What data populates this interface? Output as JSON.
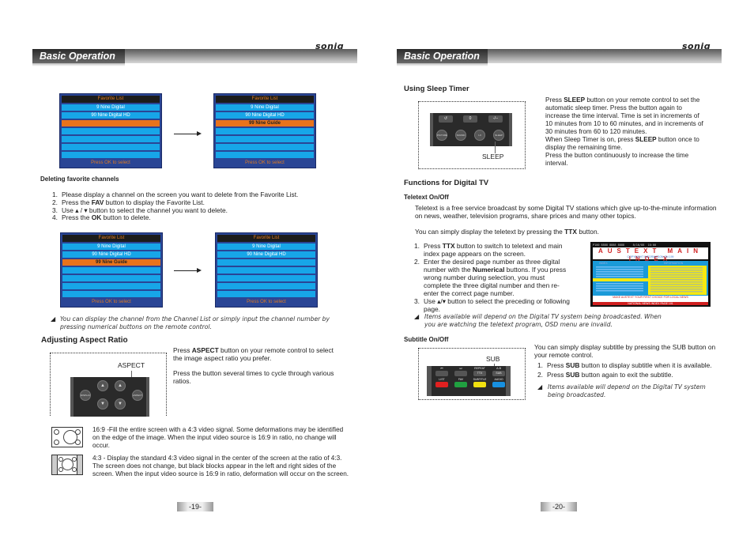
{
  "header": {
    "brand": "soniq",
    "section_title": "Basic Operation"
  },
  "left": {
    "menus_top": {
      "before": {
        "title": "Favorite List",
        "rows": [
          "9 Nine Digital",
          "90 Nine Digital HD",
          "",
          "",
          "",
          "",
          ""
        ],
        "selected_index": 2,
        "footer": "Press OK to select"
      },
      "after": {
        "title": "Favorite List",
        "rows": [
          "9 Nine Digital",
          "90 Nine Digital HD",
          "99 Nine Guide",
          "",
          "",
          "",
          ""
        ],
        "selected_index": 2,
        "footer": "Press OK to select"
      }
    },
    "deleting": {
      "heading": "Deleting favorite channels",
      "steps": [
        {
          "num": "1.",
          "pre": "Please display a channel on the screen you want to delete from the Favorite List.",
          "bold": "",
          "post": ""
        },
        {
          "num": "2.",
          "pre": "Press the ",
          "bold": "FAV",
          "post": " button to display the Favorite List."
        },
        {
          "num": "3.",
          "pre": "Use ▴ / ▾ button to select the channel you want to delete.",
          "bold": "",
          "post": ""
        },
        {
          "num": "4.",
          "pre": "Press the ",
          "bold": "OK",
          "post": " button to delete."
        }
      ]
    },
    "menus_bottom": {
      "before": {
        "title": "Favorite List",
        "rows": [
          "9 Nine Digital",
          "90 Nine Digital HD",
          "99 Nine Guide",
          "",
          "",
          "",
          ""
        ],
        "selected_index": 2,
        "footer": "Press OK to select"
      },
      "after": {
        "title": "Favorite List",
        "rows": [
          "9 Nine Digital",
          "90 Nine Digital HD",
          "",
          "",
          "",
          "",
          ""
        ],
        "selected_index": -1,
        "footer": "Press OK to select"
      }
    },
    "note": "You can display the channel from the Channel List or simply input the channel number by pressing numerical buttons on the remote control.",
    "aspect": {
      "heading": "Adjusting Aspect Ratio",
      "callout": "ASPECT",
      "remote_buttons": [
        "DISPLAY",
        "VOL",
        "CH",
        "ASPECT"
      ],
      "para1_pre": "Press ",
      "para1_bold": "ASPECT",
      "para1_post": " button on your remote control to select the image aspect ratio you prefer.",
      "para2": "Press the button several times to cycle through various ratios.",
      "modes": [
        {
          "icon": "ratio-16-9-icon",
          "text": "16:9 -Fill the entire screen with a 4:3 video signal. Some deformations may be identified on the edge of the image. When the input video source is 16:9 in ratio, no change will occur."
        },
        {
          "icon": "ratio-4-3-icon",
          "text": "4:3 - Display the standard 4:3 video signal in the center of the screen at the ratio of 4:3. The screen does not change, but black blocks appear in the left and right sides of the screen. When the input video source is 16:9 in ratio, deformation will occur on the screen."
        }
      ]
    },
    "page_number": "-19-"
  },
  "right": {
    "sleep": {
      "heading": "Using Sleep Timer",
      "callout": "SLEEP",
      "remote_top": [
        "↺",
        "0",
        "-/--"
      ],
      "remote_bottom": [
        "PICTURE",
        "SOUND",
        "I-II",
        "SLEEP"
      ],
      "lines": [
        {
          "pre": "Press ",
          "bold": "SLEEP",
          "post": " button on your remote control to set the automatic sleep timer. Press the button again to increase the time interval. Time is set in increments of 10 minutes from 10 to 60 minutes, and in increments of 30 minutes from 60 to 120 minutes."
        },
        {
          "pre": "When Sleep Timer is on, press ",
          "bold": "SLEEP",
          "post": " button once to display the remaining time."
        },
        {
          "pre": "Press the button continuously to increase the time interval.",
          "bold": "",
          "post": ""
        }
      ]
    },
    "digital": {
      "heading": "Functions for Digital TV",
      "teletext_heading": "Teletext On/Off",
      "intro": "Teletext is a free service broadcast by some Digital TV stations which give up-to-the-minute information on news, weather, television programs, share prices and many other topics.",
      "ttx_line_pre": "You can simply display the teletext by pressing the ",
      "ttx_line_bold": "TTX",
      "ttx_line_post": " button.",
      "steps": [
        {
          "num": "1.",
          "pre": "Press ",
          "bold": "TTX",
          "post": " button to switch to teletext and main index page appears on the screen."
        },
        {
          "num": "2.",
          "pre": "Enter the desired page number as three digital number with the ",
          "bold": "Numerical",
          "post": " buttons. If you press wrong number during selection, you must complete the three digital number and then re-enter the correct page number."
        },
        {
          "num": "3.",
          "pre": "Use ▴/▾ button to select the preceding or following page.",
          "bold": "",
          "post": ""
        }
      ],
      "note": "Items available will depend on the Digital TV system being broadcasted. When you are watching the teletext program, OSD menu are invalid.",
      "teletext_screen": {
        "title": "AUSTEXT MAIN INDEX",
        "subtitle": "COPYRIGHT INFORMATION ON 199",
        "col_left": "INDEX",
        "col_right": "INFORMATION",
        "bottom1": "MAKE AUSTEXT YOUR FIRST CHOICE FOR LOCAL NEWS",
        "bottom2": "NATIONAL NEWS INDEX PAGE 101"
      }
    },
    "subtitle": {
      "heading": "Subtitle On/Off",
      "callout": "SUB",
      "remote_row1": [
        "⏮",
        "⏭",
        "REPEAT",
        "A-B"
      ],
      "remote_row1_sub": [
        "",
        "",
        "TTX",
        "SUB"
      ],
      "remote_row2": [
        "LIST",
        "FAV",
        "SUBTITLE",
        "AUDIO"
      ],
      "remote_colors": [
        "#e02020",
        "#20a040",
        "#f0e010",
        "#1890e0"
      ],
      "intro": "You can simply display subtitle by pressing the SUB button on your remote control.",
      "steps": [
        {
          "num": "1.",
          "pre": "Press ",
          "bold": "SUB",
          "post": " button to display subtitle when it is available."
        },
        {
          "num": "2.",
          "pre": "Press ",
          "bold": "SUB",
          "post": " button again to exit the subtitle."
        }
      ],
      "note": "Items available will depend on the Digital TV system being broadcasted."
    },
    "page_number": "-20-"
  }
}
